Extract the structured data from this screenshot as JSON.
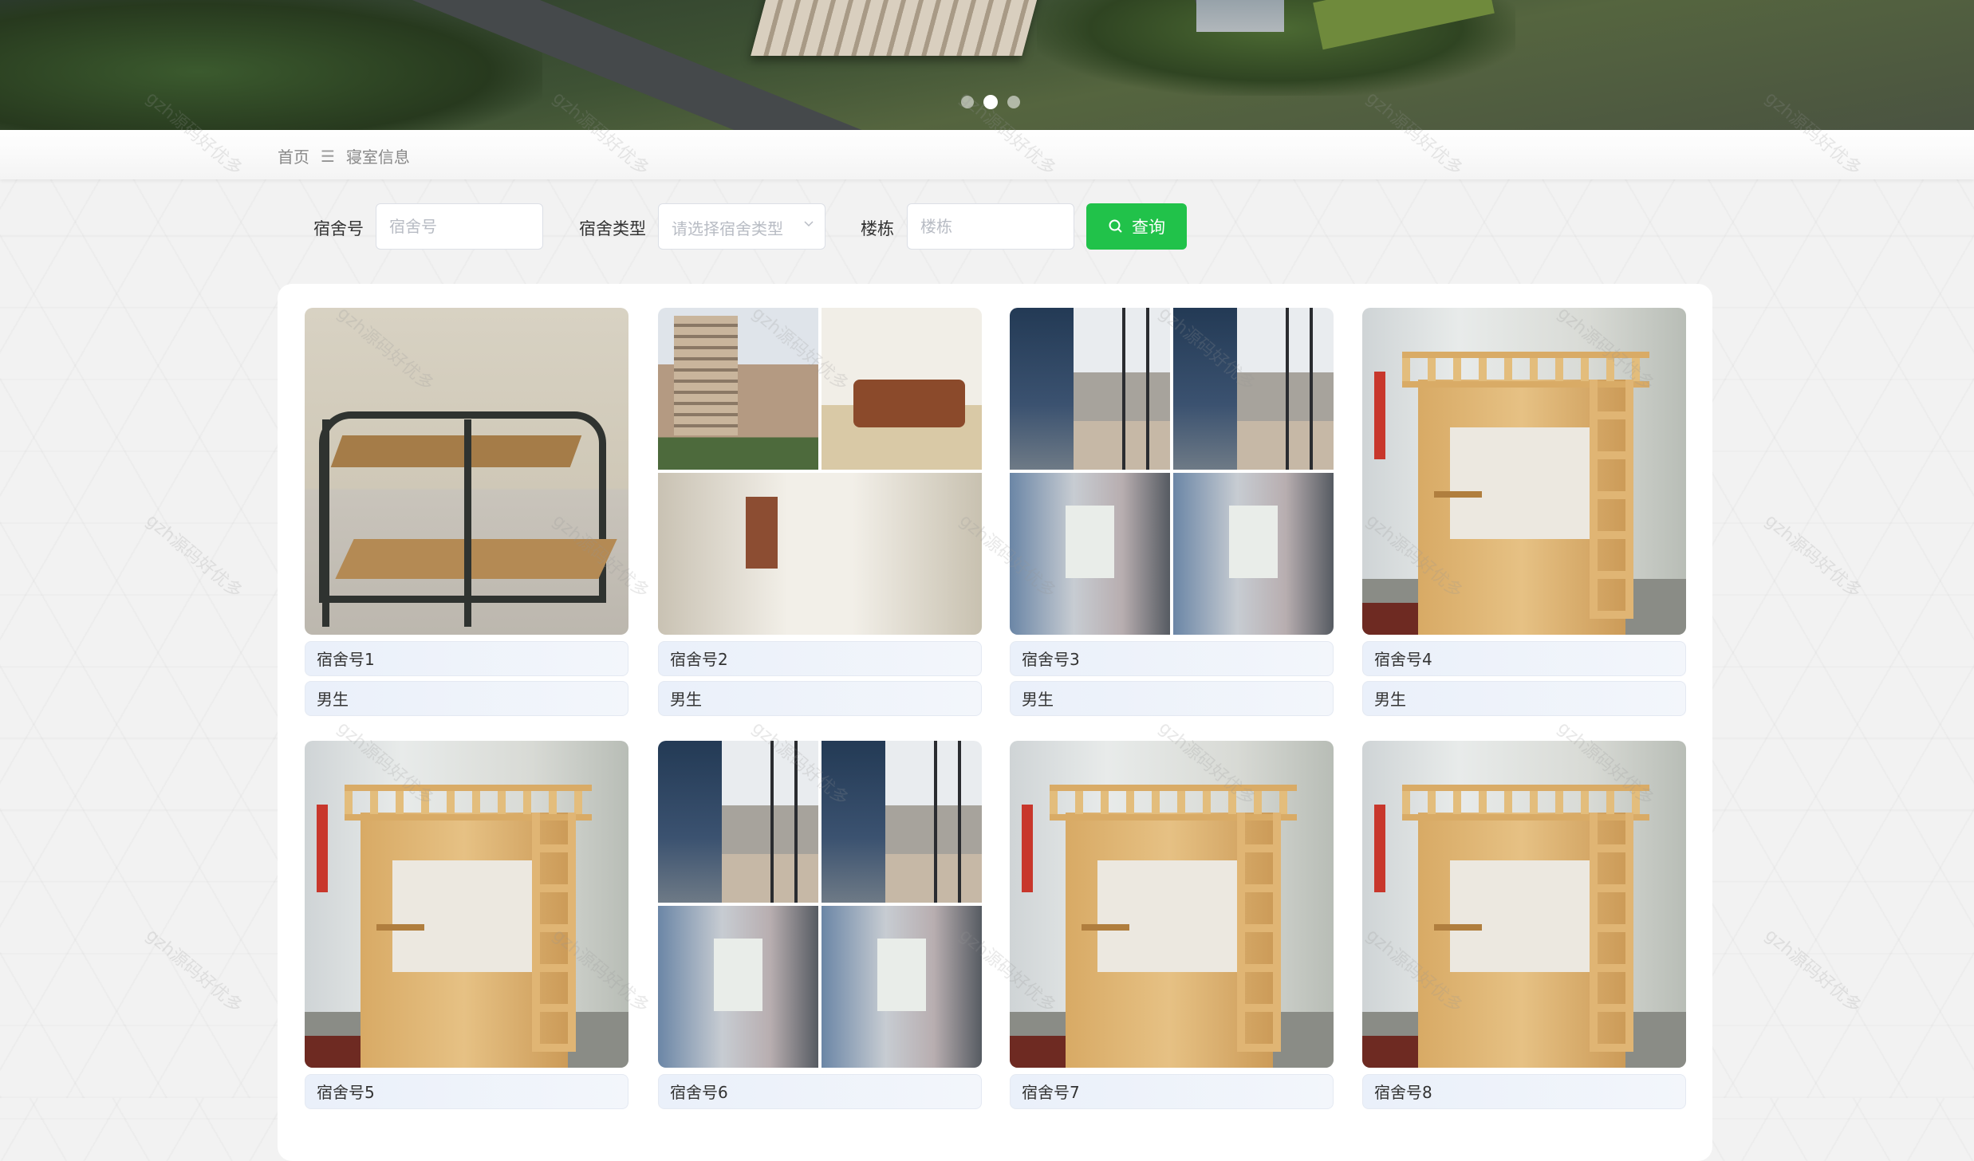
{
  "breadcrumb": {
    "home": "首页",
    "separator": "☰",
    "current": "寝室信息"
  },
  "carousel": {
    "dot_count": 3,
    "active_index": 1
  },
  "search": {
    "dorm_no_label": "宿舍号",
    "dorm_no_placeholder": "宿舍号",
    "dorm_type_label": "宿舍类型",
    "dorm_type_placeholder": "请选择宿舍类型",
    "building_label": "楼栋",
    "building_placeholder": "楼栋",
    "query_button": "查询"
  },
  "watermark": "gzh源码好优多",
  "dorms": [
    {
      "name": "宿舍号1",
      "type": "男生",
      "photo": "metal-bunk-bed"
    },
    {
      "name": "宿舍号2",
      "type": "男生",
      "photo": "building-sofa-collage"
    },
    {
      "name": "宿舍号3",
      "type": "男生",
      "photo": "dorm-collage"
    },
    {
      "name": "宿舍号4",
      "type": "男生",
      "photo": "wooden-loft-bed"
    },
    {
      "name": "宿舍号5",
      "type": "",
      "photo": "wooden-loft-bed"
    },
    {
      "name": "宿舍号6",
      "type": "",
      "photo": "dorm-collage"
    },
    {
      "name": "宿舍号7",
      "type": "",
      "photo": "wooden-loft-bed"
    },
    {
      "name": "宿舍号8",
      "type": "",
      "photo": "wooden-loft-bed"
    }
  ],
  "colors": {
    "accent": "#21c24a",
    "field_bg": "#eaf0fa"
  }
}
